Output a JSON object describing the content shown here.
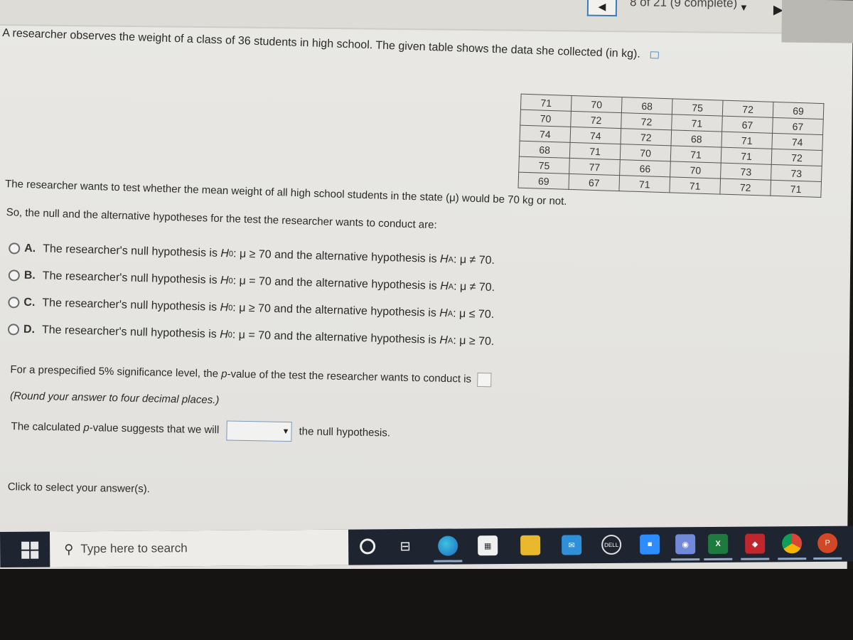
{
  "header": {
    "progress_text": "8 of 21 (9 complete)",
    "prev_icon": "triangle-left-icon",
    "next_icon": "triangle-right-icon",
    "dropdown_icon": "triangle-down-icon"
  },
  "question": {
    "intro": "A researcher observes the weight of a class of 36 students in high school. The given table shows the data she collected (in kg).",
    "table": [
      [
        "71",
        "70",
        "68",
        "75",
        "72",
        "69"
      ],
      [
        "70",
        "72",
        "72",
        "71",
        "67",
        "67"
      ],
      [
        "74",
        "74",
        "72",
        "68",
        "71",
        "74"
      ],
      [
        "68",
        "71",
        "70",
        "71",
        "71",
        "72"
      ],
      [
        "75",
        "77",
        "66",
        "70",
        "73",
        "73"
      ],
      [
        "69",
        "67",
        "71",
        "71",
        "72",
        "71"
      ]
    ],
    "test_statement": "The researcher wants to test whether the mean weight of all high school students in the state (μ) would be 70 kg or not.",
    "hypotheses_prompt": "So, the null and the alternative hypotheses for the test the researcher wants to conduct are:"
  },
  "options": [
    {
      "letter": "A.",
      "prefix": "The researcher's null hypothesis is",
      "h0": "H",
      "h0_sub": "0",
      "null_rel": ": μ ≥ 70 and the alternative hypothesis is",
      "ha": "H",
      "ha_sub": "A",
      "alt_rel": ": μ ≠ 70."
    },
    {
      "letter": "B.",
      "prefix": "The researcher's null hypothesis is",
      "h0": "H",
      "h0_sub": "0",
      "null_rel": ": μ = 70 and the alternative hypothesis is",
      "ha": "H",
      "ha_sub": "A",
      "alt_rel": ": μ ≠ 70."
    },
    {
      "letter": "C.",
      "prefix": "The researcher's null hypothesis is",
      "h0": "H",
      "h0_sub": "0",
      "null_rel": ": μ ≥ 70 and the alternative hypothesis is",
      "ha": "H",
      "ha_sub": "A",
      "alt_rel": ": μ ≤ 70."
    },
    {
      "letter": "D.",
      "prefix": "The researcher's null hypothesis is",
      "h0": "H",
      "h0_sub": "0",
      "null_rel": ": μ = 70 and the alternative hypothesis is",
      "ha": "H",
      "ha_sub": "A",
      "alt_rel": ": μ ≥ 70."
    }
  ],
  "pvalue": {
    "prompt_pre": "For a prespecified 5% significance level, the ",
    "p_italic": "p",
    "prompt_post": "-value of the test the researcher wants to conduct is",
    "input_value": "",
    "round_note": "(Round your answer to four decimal places.)",
    "suggest_pre": "The calculated ",
    "suggest_post": "-value suggests that we will",
    "select_value": "",
    "suggest_tail": "the null hypothesis."
  },
  "footer": {
    "instruction": "Click to select your answer(s)."
  },
  "taskbar": {
    "search_placeholder": "Type here to search",
    "apps": [
      "cortana",
      "task-view",
      "edge",
      "store",
      "file-explorer",
      "mail",
      "dell",
      "zoom",
      "discord",
      "excel",
      "mcafee",
      "chrome",
      "powerpoint"
    ]
  }
}
